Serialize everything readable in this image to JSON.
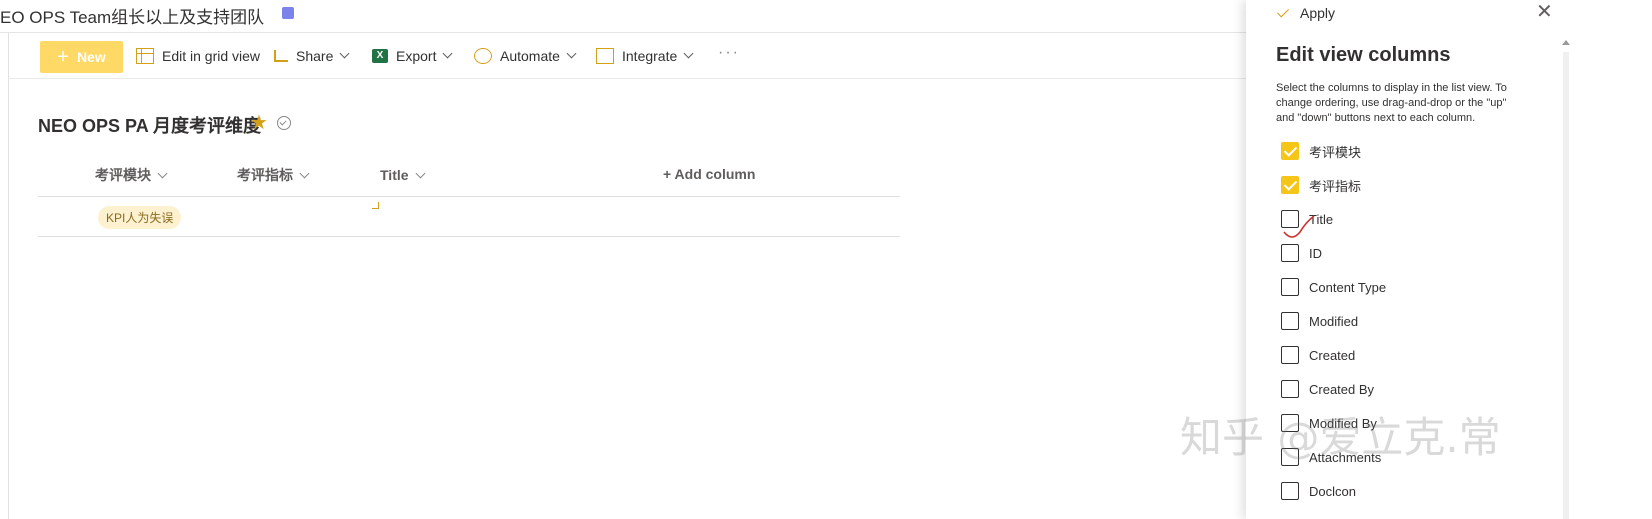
{
  "site": {
    "title": "EO OPS Team组长以上及支持团队"
  },
  "toolbar": {
    "new_label": "New",
    "new_plus": "+",
    "grid_label": "Edit in grid view",
    "share_label": "Share",
    "export_label": "Export",
    "export_icon": "X",
    "automate_label": "Automate",
    "integrate_label": "Integrate",
    "more_label": "···"
  },
  "list": {
    "title": "NEO OPS PA 月度考评维度",
    "star": "★",
    "columns": [
      "考评模块",
      "考评指标",
      "Title"
    ],
    "add_column": "+ Add column",
    "rows": [
      {
        "module": "KPI人为失误"
      }
    ]
  },
  "panel": {
    "apply_label": "Apply",
    "close_label": "✕",
    "title": "Edit view columns",
    "description": "Select the columns to display in the list view. To change ordering, use drag-and-drop or the \"up\" and \"down\" buttons next to each column.",
    "options": [
      {
        "label": "考评模块",
        "checked": true
      },
      {
        "label": "考评指标",
        "checked": true
      },
      {
        "label": "Title",
        "checked": false
      },
      {
        "label": "ID",
        "checked": false
      },
      {
        "label": "Content Type",
        "checked": false
      },
      {
        "label": "Modified",
        "checked": false
      },
      {
        "label": "Created",
        "checked": false
      },
      {
        "label": "Created By",
        "checked": false
      },
      {
        "label": "Modified By",
        "checked": false
      },
      {
        "label": "Attachments",
        "checked": false
      },
      {
        "label": "Doclcon",
        "checked": false
      }
    ]
  },
  "watermark": "知乎 @爱立克.常",
  "colors": {
    "accent": "#f5c518",
    "new_button": "#ffd966",
    "tag_bg": "#fdf1d0"
  }
}
